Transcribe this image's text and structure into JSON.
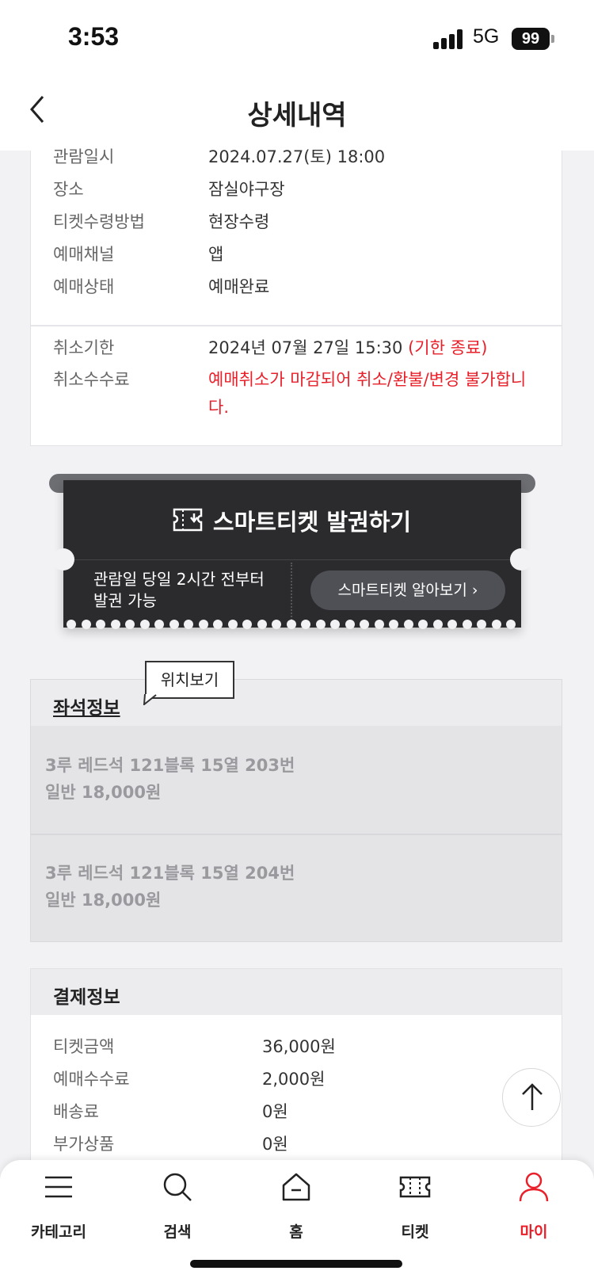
{
  "status": {
    "time": "3:53",
    "network": "5G",
    "battery": "99"
  },
  "header": {
    "title": "상세내역"
  },
  "details": [
    {
      "label": "관람일시",
      "value": "2024.07.27(토) 18:00"
    },
    {
      "label": "장소",
      "value": "잠실야구장"
    },
    {
      "label": "티켓수령방법",
      "value": "현장수령"
    },
    {
      "label": "예매채널",
      "value": "앱"
    },
    {
      "label": "예매상태",
      "value": "예매완료"
    }
  ],
  "cancel": {
    "deadline_label": "취소기한",
    "deadline_value": "2024년 07월 27일 15:30",
    "deadline_note": "(기한 종료)",
    "fee_label": "취소수수료",
    "fee_line1": "예매취소가 마감되어 취소/환불/변경 불가합니",
    "fee_line2": "다."
  },
  "smart_ticket": {
    "title": "스마트티켓 발권하기",
    "note_line1": "관람일 당일 2시간 전부터",
    "note_line2": "발권 가능",
    "guide_button": "스마트티켓 알아보기 ›"
  },
  "seat_info": {
    "title": "좌석정보",
    "tooltip": "위치보기",
    "seats": [
      {
        "seat": "3루 레드석 121블록 15열 203번",
        "price": "일반 18,000원"
      },
      {
        "seat": "3루 레드석 121블록 15열 204번",
        "price": "일반 18,000원"
      }
    ]
  },
  "payment": {
    "title": "결제정보",
    "rows": [
      {
        "label": "티켓금액",
        "value": "36,000원"
      },
      {
        "label": "예매수수료",
        "value": "2,000원"
      },
      {
        "label": "배송료",
        "value": "0원"
      },
      {
        "label": "부가상품",
        "value": "0원"
      }
    ]
  },
  "tabbar": {
    "items": [
      {
        "label": "카테고리",
        "icon": "menu-icon"
      },
      {
        "label": "검색",
        "icon": "search-icon"
      },
      {
        "label": "홈",
        "icon": "home-icon"
      },
      {
        "label": "티켓",
        "icon": "ticket-icon"
      },
      {
        "label": "마이",
        "icon": "user-icon",
        "active": true
      }
    ]
  },
  "colors": {
    "accent": "#e8202a",
    "ticket_bg": "#2b2b2e"
  }
}
